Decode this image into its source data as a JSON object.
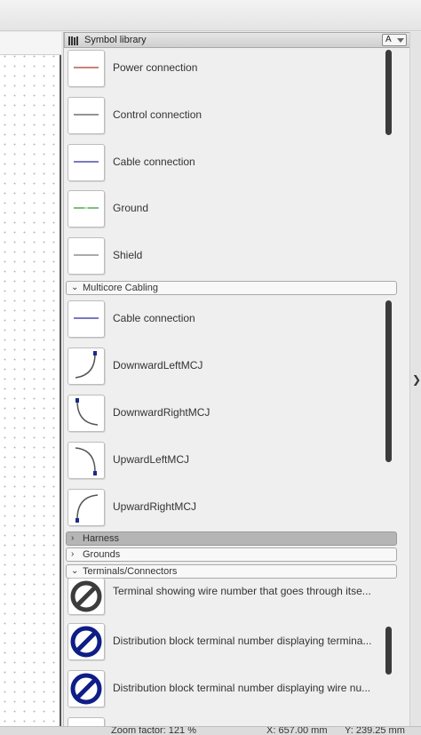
{
  "panel": {
    "title": "Symbol library",
    "sort_label": "A"
  },
  "items_top": [
    {
      "label": "Power connection",
      "line_color": "#a83a2a"
    },
    {
      "label": "Control connection",
      "line_color": "#555555"
    },
    {
      "label": "Cable connection",
      "line_color": "#2a2a9a"
    },
    {
      "label": "Ground",
      "line_color": "#2f9a2f"
    },
    {
      "label": "Shield",
      "line_color": "#777777"
    }
  ],
  "groups": [
    {
      "label": "Multicore Cabling",
      "state": "expanded"
    },
    {
      "label": "Harness",
      "state": "collapsed"
    },
    {
      "label": "Grounds",
      "state": "collapsed"
    },
    {
      "label": "Terminals/Connectors",
      "state": "expanded"
    }
  ],
  "items_multicore": [
    {
      "label": "Cable connection"
    },
    {
      "label": "DownwardLeftMCJ"
    },
    {
      "label": "DownwardRightMCJ"
    },
    {
      "label": "UpwardLeftMCJ"
    },
    {
      "label": "UpwardRightMCJ"
    }
  ],
  "items_terminals": [
    {
      "label": "Terminal showing wire number that goes through itse..."
    },
    {
      "label": "Distribution block terminal number displaying termina..."
    },
    {
      "label": "Distribution block terminal number displaying wire nu..."
    }
  ],
  "status": {
    "zoom": "Zoom factor: 121 %",
    "x": "X: 657.00 mm",
    "y": "Y: 239.25 mm"
  },
  "colors": {
    "mcj_blue": "#1b2a8a",
    "terminal_gray": "#3c3c3c",
    "terminal_navy": "#0f1d86"
  }
}
